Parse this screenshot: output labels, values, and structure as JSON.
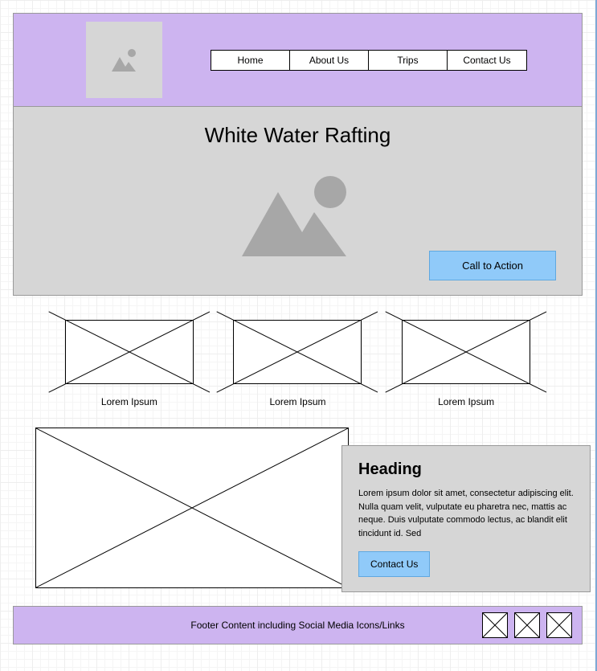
{
  "nav": {
    "items": [
      {
        "label": "Home"
      },
      {
        "label": "About Us"
      },
      {
        "label": "Trips"
      },
      {
        "label": "Contact Us"
      }
    ]
  },
  "hero": {
    "title": "White Water Rafting",
    "cta_label": "Call to Action"
  },
  "cards": [
    {
      "label": "Lorem Ipsum"
    },
    {
      "label": "Lorem Ipsum"
    },
    {
      "label": "Lorem Ipsum"
    }
  ],
  "overlay": {
    "heading": "Heading",
    "text": "Lorem ipsum dolor sit amet, consectetur adipiscing elit. Nulla quam velit, vulputate eu pharetra nec, mattis ac neque. Duis vulputate commodo lectus, ac blandit elit tincidunt id. Sed",
    "button_label": "Contact Us"
  },
  "footer": {
    "text": "Footer Content including Social Media Icons/Links"
  }
}
